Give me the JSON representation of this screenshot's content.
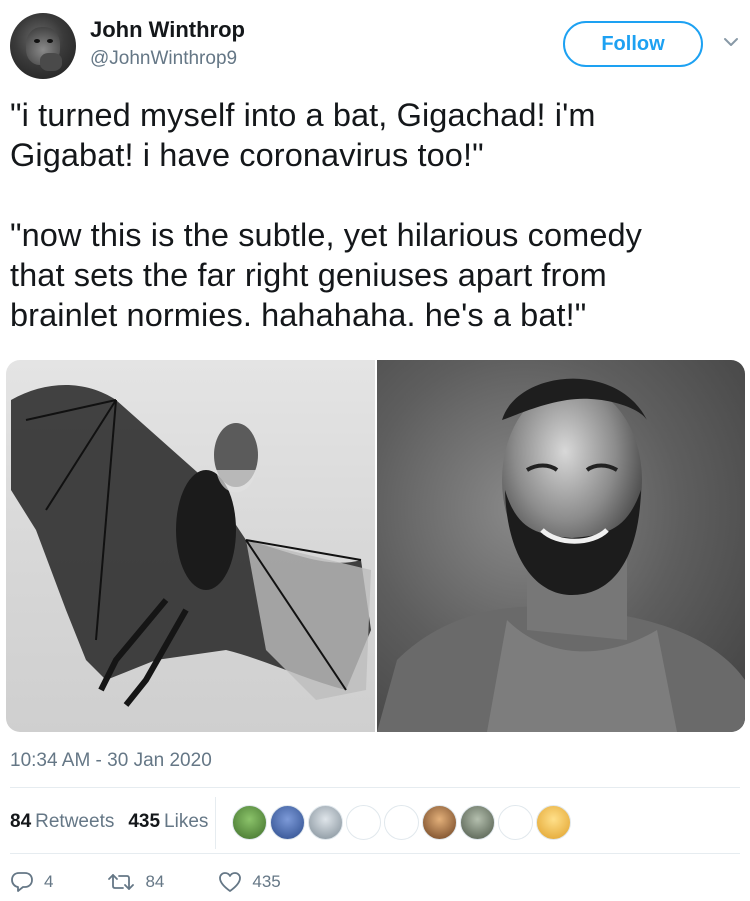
{
  "user": {
    "display_name": "John Winthrop",
    "handle": "@JohnWinthrop9",
    "avatar_icon": "gorilla-avatar"
  },
  "follow_button": {
    "label": "Follow"
  },
  "menu_icon": "chevron-down-icon",
  "tweet": {
    "lines": [
      "\"i turned myself into a bat, Gigachad! i'm",
      "Gigabat! i have coronavirus too!\"",
      "\"now this is the subtle, yet hilarious comedy",
      "that sets the far right geniuses apart from",
      "brainlet normies. hahahaha. he's a bat!\""
    ]
  },
  "media": {
    "images": [
      {
        "name": "gigabat-image",
        "description_icon": "bat-man-photo"
      },
      {
        "name": "gigachad-image",
        "description_icon": "man-portrait-photo"
      }
    ]
  },
  "timestamp": "10:34 AM - 30 Jan 2020",
  "stats": {
    "retweets_count": "84",
    "retweets_label": "Retweets",
    "likes_count": "435",
    "likes_label": "Likes"
  },
  "likers": [
    {
      "color": "#5a8a3c"
    },
    {
      "color": "#3b5fa8"
    },
    {
      "color": "#9aa7b0"
    },
    {
      "color": "#ffffff"
    },
    {
      "color": "#ffffff"
    },
    {
      "color": "#b07a4a"
    },
    {
      "color": "#6f7a6a"
    },
    {
      "color": "#ffffff"
    },
    {
      "color": "#f2c14e"
    }
  ],
  "actions": {
    "reply_count": "4",
    "retweet_count": "84",
    "like_count": "435"
  },
  "colors": {
    "accent": "#1da1f2",
    "secondary_text": "#657786",
    "primary_text": "#14171a"
  }
}
